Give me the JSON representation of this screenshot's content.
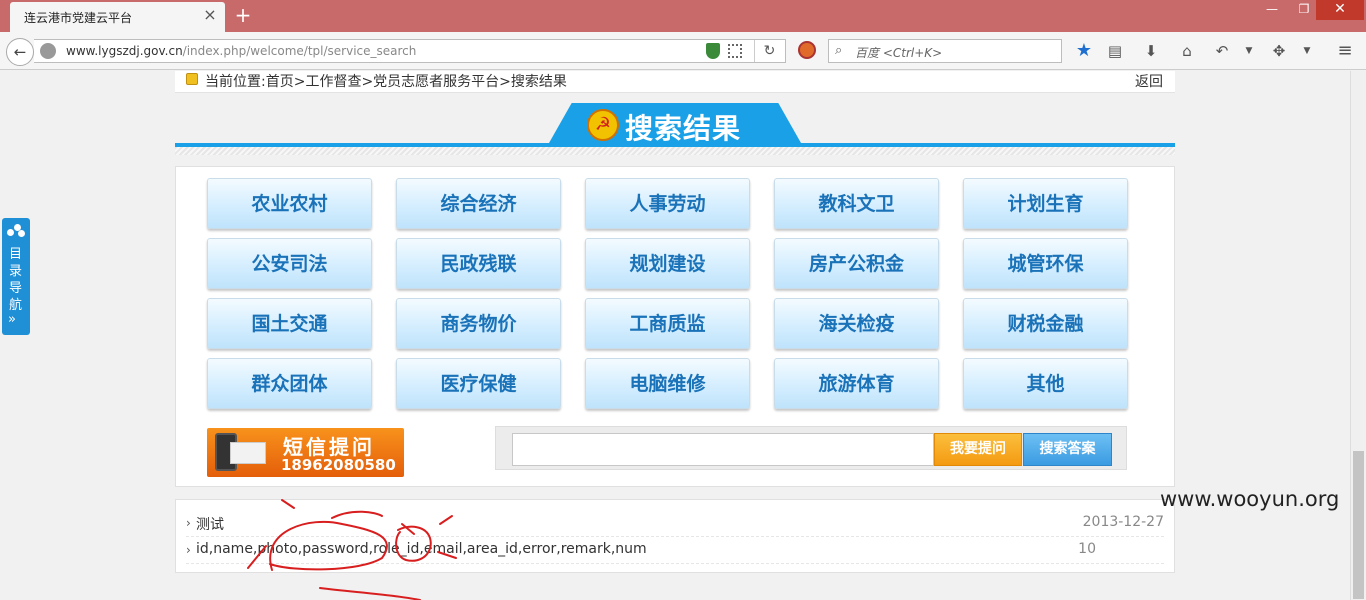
{
  "browser": {
    "tab_title": "连云港市党建云平台",
    "url_domain": "www.lygszdj.gov.cn",
    "url_path": "/index.php/welcome/tpl/service_search",
    "search_placeholder": "百度 <Ctrl+K>",
    "icons": [
      "back-icon",
      "globe-icon",
      "shield-icon",
      "qr-icon",
      "reload-icon",
      "block-icon",
      "search-icon",
      "star-icon",
      "reader-icon",
      "download-icon",
      "home-icon",
      "undo-icon",
      "extension-icon",
      "menu-icon"
    ]
  },
  "breadcrumb": {
    "text": "当前位置:首页>工作督查>党员志愿者服务平台>搜索结果",
    "back": "返回"
  },
  "header": {
    "title": "搜索结果",
    "accent": "#1aa0e6"
  },
  "categories": [
    [
      "农业农村",
      "综合经济",
      "人事劳动",
      "教科文卫",
      "计划生育"
    ],
    [
      "公安司法",
      "民政残联",
      "规划建设",
      "房产公积金",
      "城管环保"
    ],
    [
      "国土交通",
      "商务物价",
      "工商质监",
      "海关检疫",
      "财税金融"
    ],
    [
      "群众团体",
      "医疗保健",
      "电脑维修",
      "旅游体育",
      "其他"
    ]
  ],
  "sms": {
    "title": "短信提问",
    "number": "18962080580"
  },
  "search": {
    "value": "",
    "ask_label": "我要提问",
    "find_label": "搜索答案"
  },
  "results": [
    {
      "title": "测试",
      "meta": "2013-12-27"
    },
    {
      "title": "id,name,photo,password,role_id,email,area_id,error,remark,num",
      "meta": "10"
    }
  ],
  "side_nav": {
    "label": "目录导航",
    "arrow": "»"
  },
  "watermark": "www.wooyun.org"
}
